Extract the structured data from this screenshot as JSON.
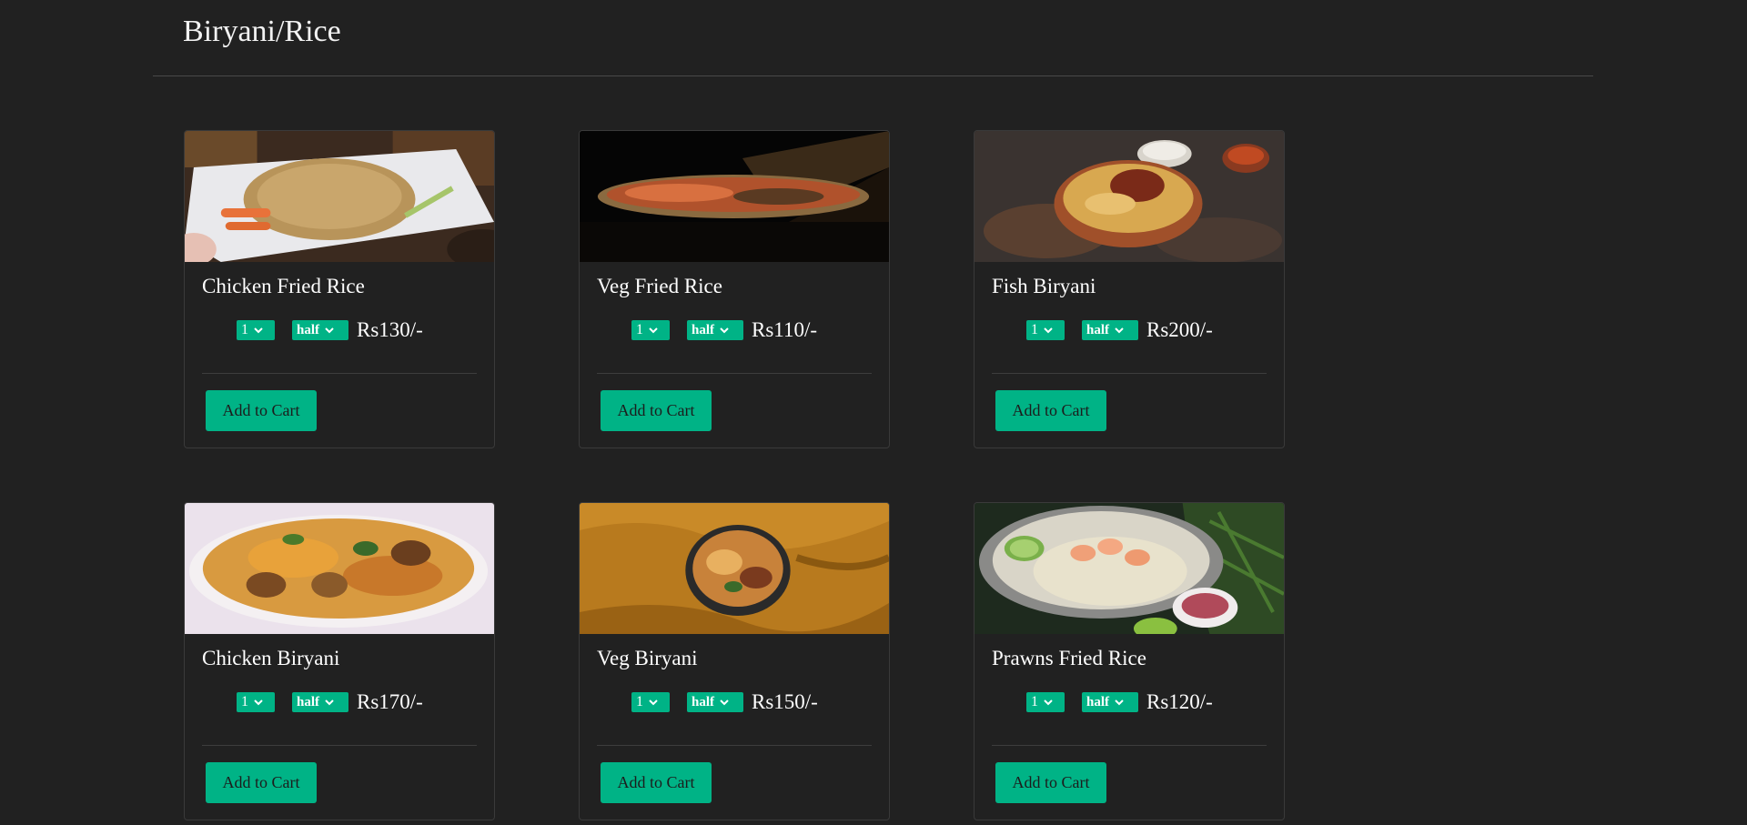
{
  "category": {
    "title": "Biryani/Rice"
  },
  "colors": {
    "accent": "#00b386",
    "background": "#212121"
  },
  "items": [
    {
      "name": "Chicken Fried Rice",
      "qty": "1",
      "size": "half",
      "price": "Rs130/-",
      "button": "Add to Cart",
      "image_icon": "chicken-fried-rice-photo"
    },
    {
      "name": "Veg Fried Rice",
      "qty": "1",
      "size": "half",
      "price": "Rs110/-",
      "button": "Add to Cart",
      "image_icon": "veg-fried-rice-photo"
    },
    {
      "name": "Fish Biryani",
      "qty": "1",
      "size": "half",
      "price": "Rs200/-",
      "button": "Add to Cart",
      "image_icon": "fish-biryani-photo"
    },
    {
      "name": "Chicken Biryani",
      "qty": "1",
      "size": "half",
      "price": "Rs170/-",
      "button": "Add to Cart",
      "image_icon": "chicken-biryani-photo"
    },
    {
      "name": "Veg Biryani",
      "qty": "1",
      "size": "half",
      "price": "Rs150/-",
      "button": "Add to Cart",
      "image_icon": "veg-biryani-photo"
    },
    {
      "name": "Prawns Fried Rice",
      "qty": "1",
      "size": "half",
      "price": "Rs120/-",
      "button": "Add to Cart",
      "image_icon": "prawns-fried-rice-photo"
    }
  ]
}
